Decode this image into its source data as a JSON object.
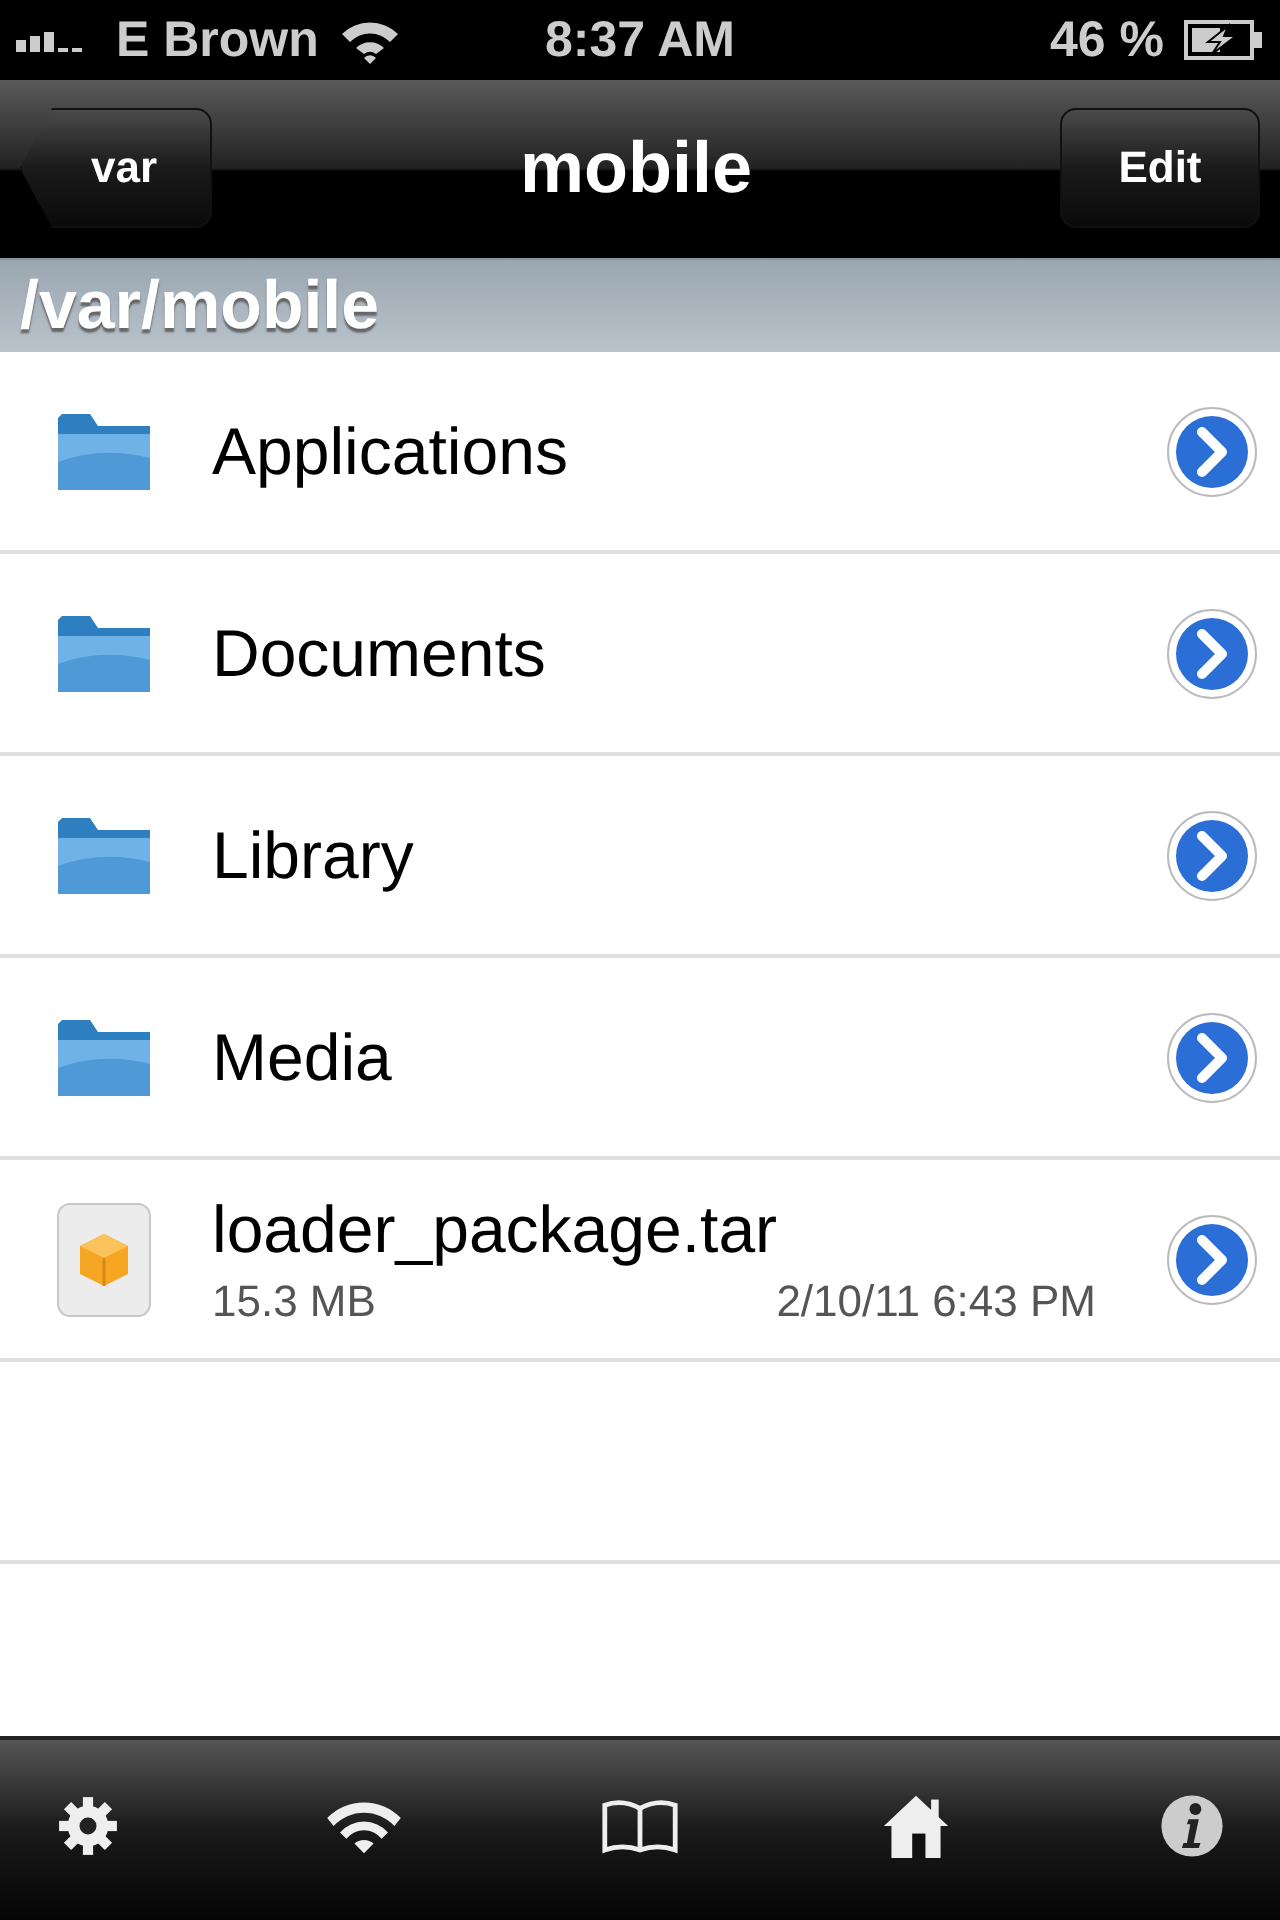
{
  "status_bar": {
    "carrier": "E Brown",
    "time": "8:37 AM",
    "battery": "46 %"
  },
  "nav_bar": {
    "back": "var",
    "title": "mobile",
    "action": "Edit"
  },
  "path": "/var/mobile",
  "files": [
    {
      "kind": "folder",
      "name": "Applications"
    },
    {
      "kind": "folder",
      "name": "Documents"
    },
    {
      "kind": "folder",
      "name": "Library"
    },
    {
      "kind": "folder",
      "name": "Media"
    },
    {
      "kind": "package",
      "name": "loader_package.tar",
      "size": "15.3 MB",
      "date": "2/10/11 6:43 PM"
    }
  ],
  "tab_bar": [
    {
      "kind": "settings"
    },
    {
      "kind": "wifi"
    },
    {
      "kind": "book"
    },
    {
      "kind": "home"
    },
    {
      "kind": "info"
    }
  ]
}
